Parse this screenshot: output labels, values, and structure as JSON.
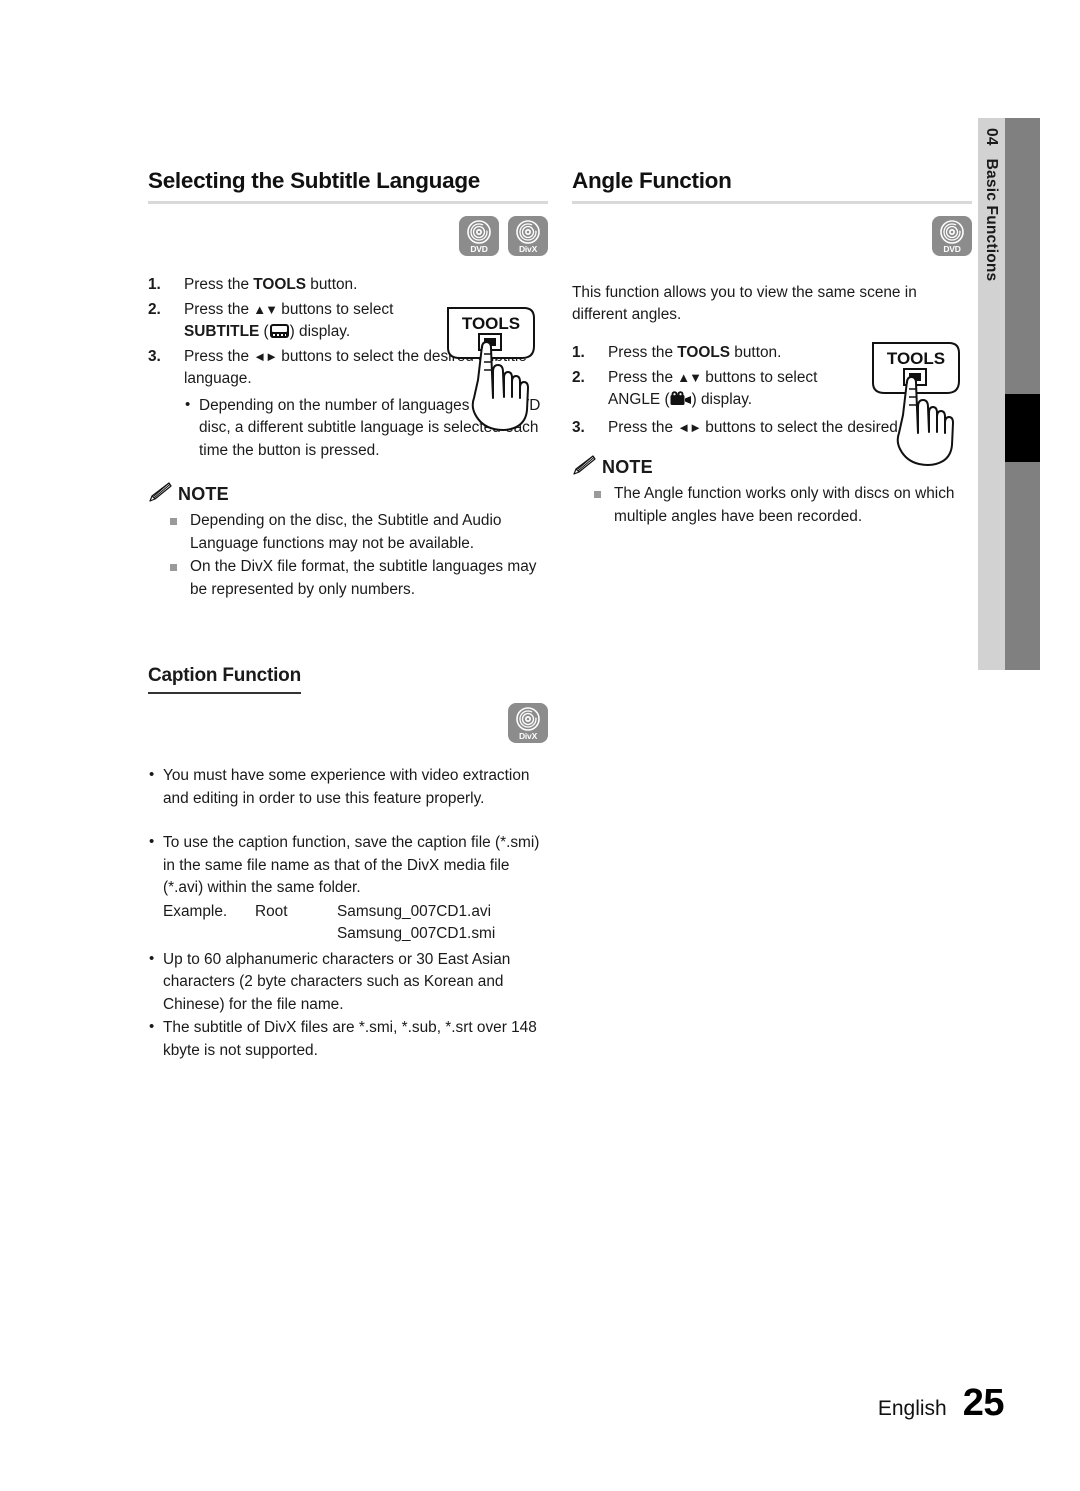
{
  "page": {
    "chapter_number": "04",
    "chapter_title": "Basic Functions",
    "footer_language": "English",
    "footer_page_number": "25",
    "accent_gray": "#808080",
    "tab_gray": "#d2d2d2",
    "badge_gray": "#8c8c8c"
  },
  "left_column": {
    "section_title": "Selecting the Subtitle Language",
    "badges": [
      {
        "icon": "disc-icon",
        "label": "DVD"
      },
      {
        "icon": "disc-icon",
        "label": "DivX"
      }
    ],
    "steps": [
      {
        "number": "1.",
        "before": "Press the ",
        "bold": "TOOLS",
        "after": " button."
      },
      {
        "number": "2.",
        "before": "Press the ",
        "arrows": "▲▼",
        "after": " buttons to select",
        "line2_bold": "SUBTITLE",
        "line2_icon": "subtitle-icon",
        "line2_after": ") display."
      },
      {
        "number": "3.",
        "before": "Press the ",
        "arrows": "◄►",
        "after": " buttons to select the desired subtitle language."
      }
    ],
    "step_bullet": "Depending on the number of languages on a DVD disc, a different subtitle language is selected each time the button is pressed.",
    "note_label": "NOTE",
    "note_items": [
      "Depending on the disc, the Subtitle and Audio Language functions may not be available.",
      "On the DivX file format, the subtitle languages may be represented by only numbers."
    ],
    "tools_button_label": "TOOLS"
  },
  "caption_section": {
    "sub_title": "Caption Function",
    "badges": [
      {
        "icon": "disc-icon",
        "label": "DivX"
      }
    ],
    "bullets": [
      "You must have some experience with video extraction and editing in order to use this feature properly.",
      "To use the caption function, save the caption file (*.smi) in the same file name as that of the DivX media file (*.avi) within the same folder.",
      "Up to 60 alphanumeric characters or 30 East Asian characters (2 byte characters such as Korean and Chinese) for the file name.",
      "The subtitle of DivX files are *.smi, *.sub, *.srt over 148 kbyte is not supported."
    ],
    "example_label": "Example.",
    "example_root": "Root",
    "example_file_avi": "Samsung_007CD1.avi",
    "example_file_smi": "Samsung_007CD1.smi"
  },
  "right_column": {
    "section_title": "Angle Function",
    "badges": [
      {
        "icon": "disc-icon",
        "label": "DVD"
      }
    ],
    "intro": "This function allows you to view the same scene in different angles.",
    "steps": [
      {
        "number": "1.",
        "before": "Press the ",
        "bold": "TOOLS",
        "after": " button."
      },
      {
        "number": "2.",
        "before": "Press the ",
        "arrows": "▲▼",
        "after": " buttons to select",
        "line2_text": "ANGLE (",
        "line2_icon": "camera-icon",
        "line2_after": ") display."
      },
      {
        "number": "3.",
        "before": "Press the ",
        "arrows": "◄►",
        "after": " buttons to select the desired angle."
      }
    ],
    "note_label": "NOTE",
    "note_items": [
      "The Angle function works only with discs on which multiple angles have been recorded."
    ],
    "tools_button_label": "TOOLS"
  }
}
